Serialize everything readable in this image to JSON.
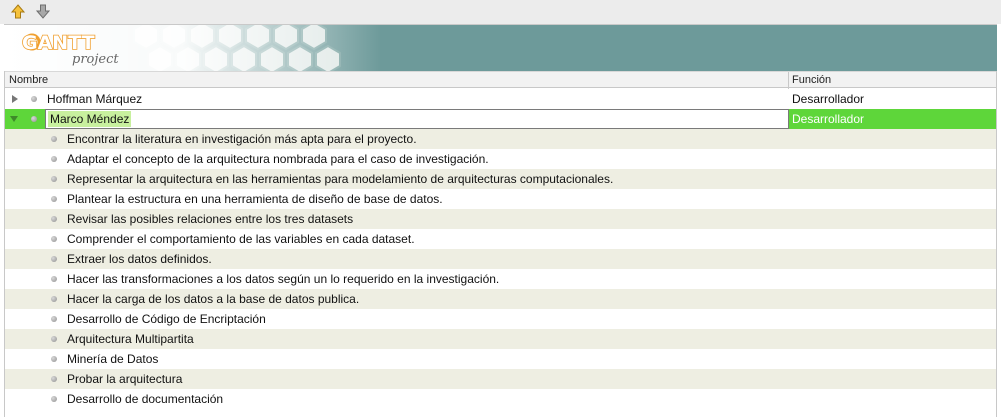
{
  "toolbar": {
    "up_icon": "arrow-up-icon",
    "down_icon": "arrow-down-icon"
  },
  "logo": {
    "main": "GANTT",
    "sub": "project"
  },
  "columns": {
    "name": "Nombre",
    "function": "Función"
  },
  "resources": [
    {
      "name": "Hoffman Márquez",
      "function": "Desarrollador",
      "expanded": false,
      "selected": false
    },
    {
      "name": "Marco Méndez",
      "function": "Desarrollador",
      "expanded": true,
      "selected": true
    }
  ],
  "tasks": [
    "Encontrar la literatura en investigación más apta para el proyecto.",
    "Adaptar el concepto de la arquitectura nombrada para el caso de investigación.",
    "Representar la arquitectura en las herramientas para modelamiento de arquitecturas computacionales.",
    "Plantear la estructura en una herramienta de diseño de base de datos.",
    "Revisar las posibles relaciones entre los tres datasets",
    "Comprender el comportamiento de las variables en cada dataset.",
    "Extraer los datos definidos.",
    "Hacer las transformaciones a los datos según un lo requerido en la investigación.",
    "Hacer la carga de los datos a la base de datos publica.",
    "Desarrollo de Código de Encriptación",
    "Arquitectura Multipartita",
    "Minería de Datos",
    "Probar la arquitectura",
    "Desarrollo de documentación"
  ],
  "colors": {
    "selected_row": "#5ed63a",
    "alt_row": "#eeeee2",
    "banner": "#6d9a9a",
    "logo_orange": "#f0a030"
  }
}
